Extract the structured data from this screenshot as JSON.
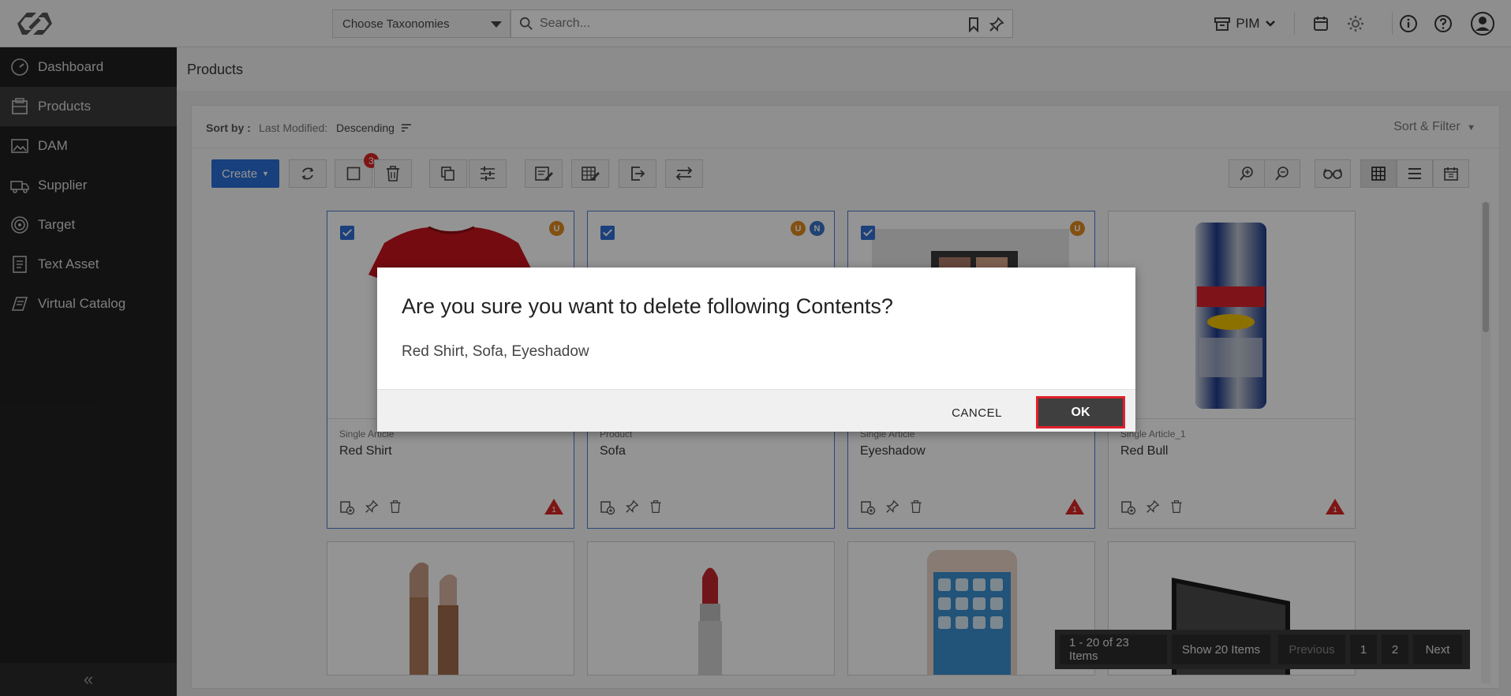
{
  "header": {
    "taxonomy_label": "Choose Taxonomies",
    "search_placeholder": "Search...",
    "module_label": "PIM"
  },
  "sidebar": {
    "items": [
      {
        "label": "Dashboard",
        "icon": "dashboard-icon"
      },
      {
        "label": "Products",
        "icon": "products-icon",
        "active": true
      },
      {
        "label": "DAM",
        "icon": "image-icon"
      },
      {
        "label": "Supplier",
        "icon": "truck-icon"
      },
      {
        "label": "Target",
        "icon": "target-icon"
      },
      {
        "label": "Text Asset",
        "icon": "document-icon"
      },
      {
        "label": "Virtual Catalog",
        "icon": "catalog-icon"
      }
    ],
    "collapse_glyph": "«"
  },
  "page": {
    "title": "Products"
  },
  "sort": {
    "label": "Sort by :",
    "field": "Last Modified:",
    "order": "Descending",
    "sort_filter": "Sort & Filter"
  },
  "toolbar": {
    "create_label": "Create",
    "selected_count": "3"
  },
  "products": [
    {
      "type": "Single Article",
      "name": "Red Shirt",
      "selected": true,
      "status": [
        "U"
      ],
      "warning": "1"
    },
    {
      "type": "Product",
      "name": "Sofa",
      "selected": true,
      "status": [
        "U",
        "N"
      ],
      "warning": ""
    },
    {
      "type": "Single Article",
      "name": "Eyeshadow",
      "selected": true,
      "status": [
        "U"
      ],
      "warning": "1"
    },
    {
      "type": "Single Article_1",
      "name": "Red Bull",
      "selected": false,
      "status": [],
      "warning": "1"
    }
  ],
  "pagination": {
    "range": "1 - 20 of 23 Items",
    "show": "Show 20 Items",
    "previous": "Previous",
    "page1": "1",
    "page2": "2",
    "next": "Next"
  },
  "dialog": {
    "title": "Are you sure you want to delete following Contents?",
    "message": "Red Shirt, Sofa, Eyeshadow",
    "cancel": "CANCEL",
    "ok": "OK"
  },
  "colors": {
    "accent": "#2a6fd6",
    "sidebar": "#202020",
    "warning": "#d92525",
    "ok_highlight": "#e01f2a"
  }
}
